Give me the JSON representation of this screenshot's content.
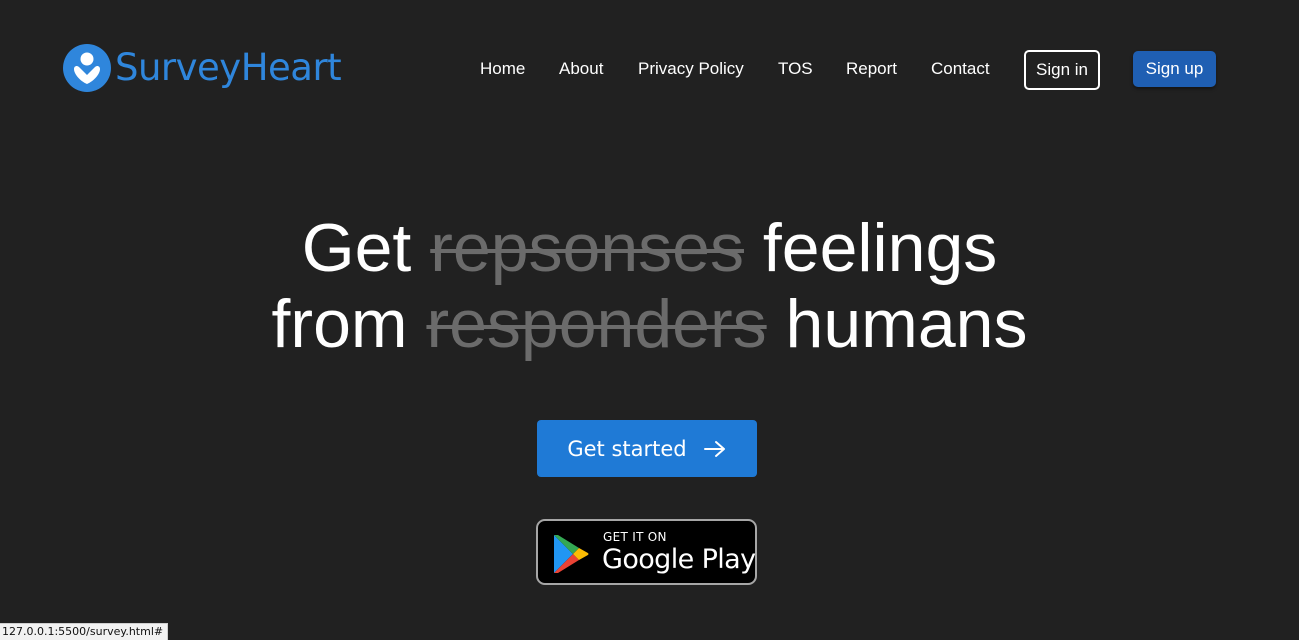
{
  "brand": {
    "name": "SurveyHeart",
    "color": "#2f86dc",
    "icon": "person-heart-icon"
  },
  "nav": [
    {
      "label": "Home"
    },
    {
      "label": "About"
    },
    {
      "label": "Privacy Policy"
    },
    {
      "label": "TOS"
    },
    {
      "label": "Report"
    },
    {
      "label": "Contact"
    }
  ],
  "auth": {
    "signin": "Sign in",
    "signup": "Sign up",
    "signup_color": "#1f5fb3"
  },
  "hero": {
    "line1": {
      "pre": "Get",
      "struck": "repsonses",
      "post": "feelings"
    },
    "line2": {
      "pre": "from",
      "struck": "responders",
      "post": "humans"
    }
  },
  "cta": {
    "label": "Get started",
    "icon": "arrow-right-icon",
    "color": "#1f7ad6"
  },
  "store_badge": {
    "small": "GET IT ON",
    "big": "Google Play",
    "icon": "google-play-icon"
  },
  "status_bar": {
    "url": "127.0.0.1:5500/survey.html#"
  }
}
